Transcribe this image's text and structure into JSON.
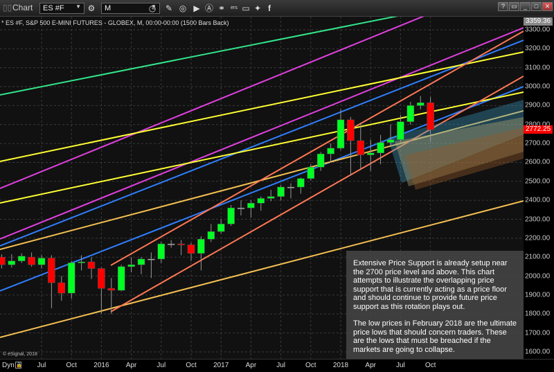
{
  "window": {
    "title": "Chart",
    "symbol": "ES #F",
    "interval": "M",
    "buttons": [
      "?",
      "restore",
      "minimize",
      "maximize",
      "close"
    ]
  },
  "chart_info": "* ES #F, S&P 500 E-MINI FUTURES - GLOBEX, M, 00:00-00:00 (1500 Bars Back)",
  "copyright": "© eSignal, 2018",
  "dyn_label": "Dyn",
  "price_tags": {
    "high": "3359.36",
    "last": "2772.25"
  },
  "colors": {
    "up": "#00ff22",
    "down": "#ff0000",
    "last_tag": "#ff0000"
  },
  "note": {
    "p1": "Extensive Price Support is already setup near the 2700 price level and above.  This chart attempts to illustrate the overlapping price support that is currently acting as a price floor and should continue to provide future price support as this rotation plays out.",
    "p2": "The low prices in February 2018 are the ultimate price lows that should concern traders.  These are the lows that must be breached if the markets are going to collapse."
  },
  "chart_data": {
    "type": "candlestick",
    "title": "ES #F, S&P 500 E-MINI FUTURES - GLOBEX, M",
    "ylim": [
      1560,
      3360
    ],
    "y_ticks": [
      "3300.00",
      "3200.00",
      "3100.00",
      "3000.00",
      "2900.00",
      "2800.00",
      "2700.00",
      "2600.00",
      "2500.00",
      "2400.00",
      "2300.00",
      "2200.00",
      "2100.00",
      "2000.00",
      "1900.00",
      "1800.00",
      "1700.00",
      "1600.00"
    ],
    "x_ticks": [
      {
        "label": "Jul",
        "m": 4
      },
      {
        "label": "Oct",
        "m": 7
      },
      {
        "label": "2016",
        "m": 10
      },
      {
        "label": "Apr",
        "m": 13
      },
      {
        "label": "Jul",
        "m": 16
      },
      {
        "label": "Oct",
        "m": 19
      },
      {
        "label": "2017",
        "m": 22
      },
      {
        "label": "Apr",
        "m": 25
      },
      {
        "label": "Jul",
        "m": 28
      },
      {
        "label": "Oct",
        "m": 31
      },
      {
        "label": "2018",
        "m": 34
      },
      {
        "label": "Apr",
        "m": 37
      },
      {
        "label": "Jul",
        "m": 40
      },
      {
        "label": "Oct",
        "m": 43
      }
    ],
    "start_month": "2015-03",
    "ohlc": [
      [
        2100,
        2115,
        2040,
        2060
      ],
      [
        2060,
        2115,
        2045,
        2080
      ],
      [
        2080,
        2120,
        2070,
        2105
      ],
      [
        2100,
        2125,
        2050,
        2060
      ],
      [
        2060,
        2110,
        2040,
        2095
      ],
      [
        2095,
        2110,
        1830,
        1965
      ],
      [
        1965,
        2000,
        1870,
        1910
      ],
      [
        1910,
        2080,
        1880,
        2070
      ],
      [
        2070,
        2110,
        2030,
        2075
      ],
      [
        2075,
        2100,
        1985,
        2040
      ],
      [
        2040,
        2045,
        1800,
        1935
      ],
      [
        1935,
        1990,
        1800,
        1925
      ],
      [
        1925,
        2060,
        1920,
        2050
      ],
      [
        2050,
        2100,
        2020,
        2060
      ],
      [
        2060,
        2100,
        2010,
        2090
      ],
      [
        2090,
        2125,
        1990,
        2090
      ],
      [
        2090,
        2180,
        2070,
        2170
      ],
      [
        2170,
        2190,
        2150,
        2170
      ],
      [
        2170,
        2190,
        2110,
        2165
      ],
      [
        2165,
        2175,
        2080,
        2120
      ],
      [
        2120,
        2210,
        2030,
        2195
      ],
      [
        2195,
        2275,
        2180,
        2235
      ],
      [
        2235,
        2300,
        2225,
        2275
      ],
      [
        2275,
        2375,
        2265,
        2360
      ],
      [
        2360,
        2400,
        2320,
        2360
      ],
      [
        2360,
        2400,
        2310,
        2385
      ],
      [
        2385,
        2420,
        2345,
        2410
      ],
      [
        2410,
        2455,
        2395,
        2420
      ],
      [
        2420,
        2480,
        2400,
        2470
      ],
      [
        2470,
        2490,
        2410,
        2470
      ],
      [
        2470,
        2520,
        2435,
        2515
      ],
      [
        2515,
        2590,
        2505,
        2575
      ],
      [
        2575,
        2655,
        2555,
        2645
      ],
      [
        2645,
        2700,
        2600,
        2675
      ],
      [
        2675,
        2880,
        2665,
        2825
      ],
      [
        2825,
        2840,
        2530,
        2715
      ],
      [
        2715,
        2810,
        2560,
        2640
      ],
      [
        2640,
        2720,
        2555,
        2650
      ],
      [
        2650,
        2745,
        2590,
        2705
      ],
      [
        2705,
        2800,
        2690,
        2720
      ],
      [
        2720,
        2850,
        2700,
        2815
      ],
      [
        2815,
        2920,
        2800,
        2900
      ],
      [
        2900,
        2950,
        2880,
        2915
      ],
      [
        2915,
        2945,
        2710,
        2772
      ]
    ]
  }
}
